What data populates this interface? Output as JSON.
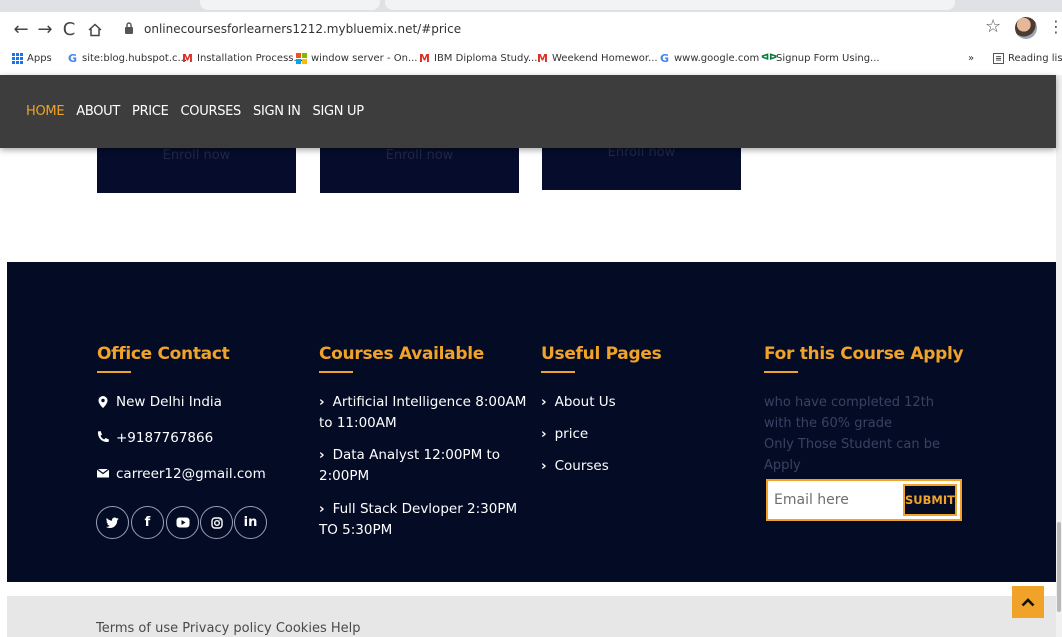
{
  "browser": {
    "url": "onlinecoursesforlearners1212.mybluemix.net/#price",
    "bookmarks": [
      {
        "label": "Apps",
        "icon": "apps-grid-icon"
      },
      {
        "label": "site:blog.hubspot.c...",
        "icon": "google-icon"
      },
      {
        "label": "Installation Process...",
        "icon": "gmail-icon"
      },
      {
        "label": "window server - On...",
        "icon": "windows-icon"
      },
      {
        "label": "IBM Diploma Study...",
        "icon": "gmail-icon"
      },
      {
        "label": "Weekend Homewor...",
        "icon": "gmail-icon"
      },
      {
        "label": "www.google.com",
        "icon": "google-icon"
      },
      {
        "label": "Signup Form Using...",
        "icon": "link-icon"
      }
    ],
    "more_bookmarks": "»",
    "reading_list": "Reading list"
  },
  "nav": {
    "links": [
      "HOME",
      "ABOUT",
      "PRICE",
      "COURSES",
      "SIGN IN",
      "SIGN UP"
    ],
    "active": "HOME"
  },
  "cards": {
    "enroll_label": "Enroll now"
  },
  "footer": {
    "office": {
      "title": "Office Contact",
      "address": "New Delhi India",
      "phone": "+9187767866",
      "email": "carreer12@gmail.com",
      "social": [
        "twitter-icon",
        "facebook-icon",
        "youtube-icon",
        "instagram-icon",
        "linkedin-icon"
      ]
    },
    "courses": {
      "title": "Courses Available",
      "items": [
        "Artificial Intelligence 8:00AM to 11:00AM",
        "Data Analyst 12:00PM to 2:00PM",
        "Full Stack Devloper 2:30PM TO 5:30PM"
      ]
    },
    "useful": {
      "title": "Useful Pages",
      "items": [
        "About Us",
        "price",
        "Courses"
      ]
    },
    "apply": {
      "title": "For this Course Apply",
      "text_line1": "who have completed 12th with the 60% grade",
      "text_line2": "Only Those Student can be Apply",
      "email_placeholder": "Email here",
      "submit_label": "SUBMIT"
    }
  },
  "bottom": {
    "links": "Terms of use Privacy policy Cookies Help"
  },
  "colors": {
    "accent": "#f0a328",
    "footer_bg": "#040b25",
    "nav_bg": "#3d3d3d"
  }
}
